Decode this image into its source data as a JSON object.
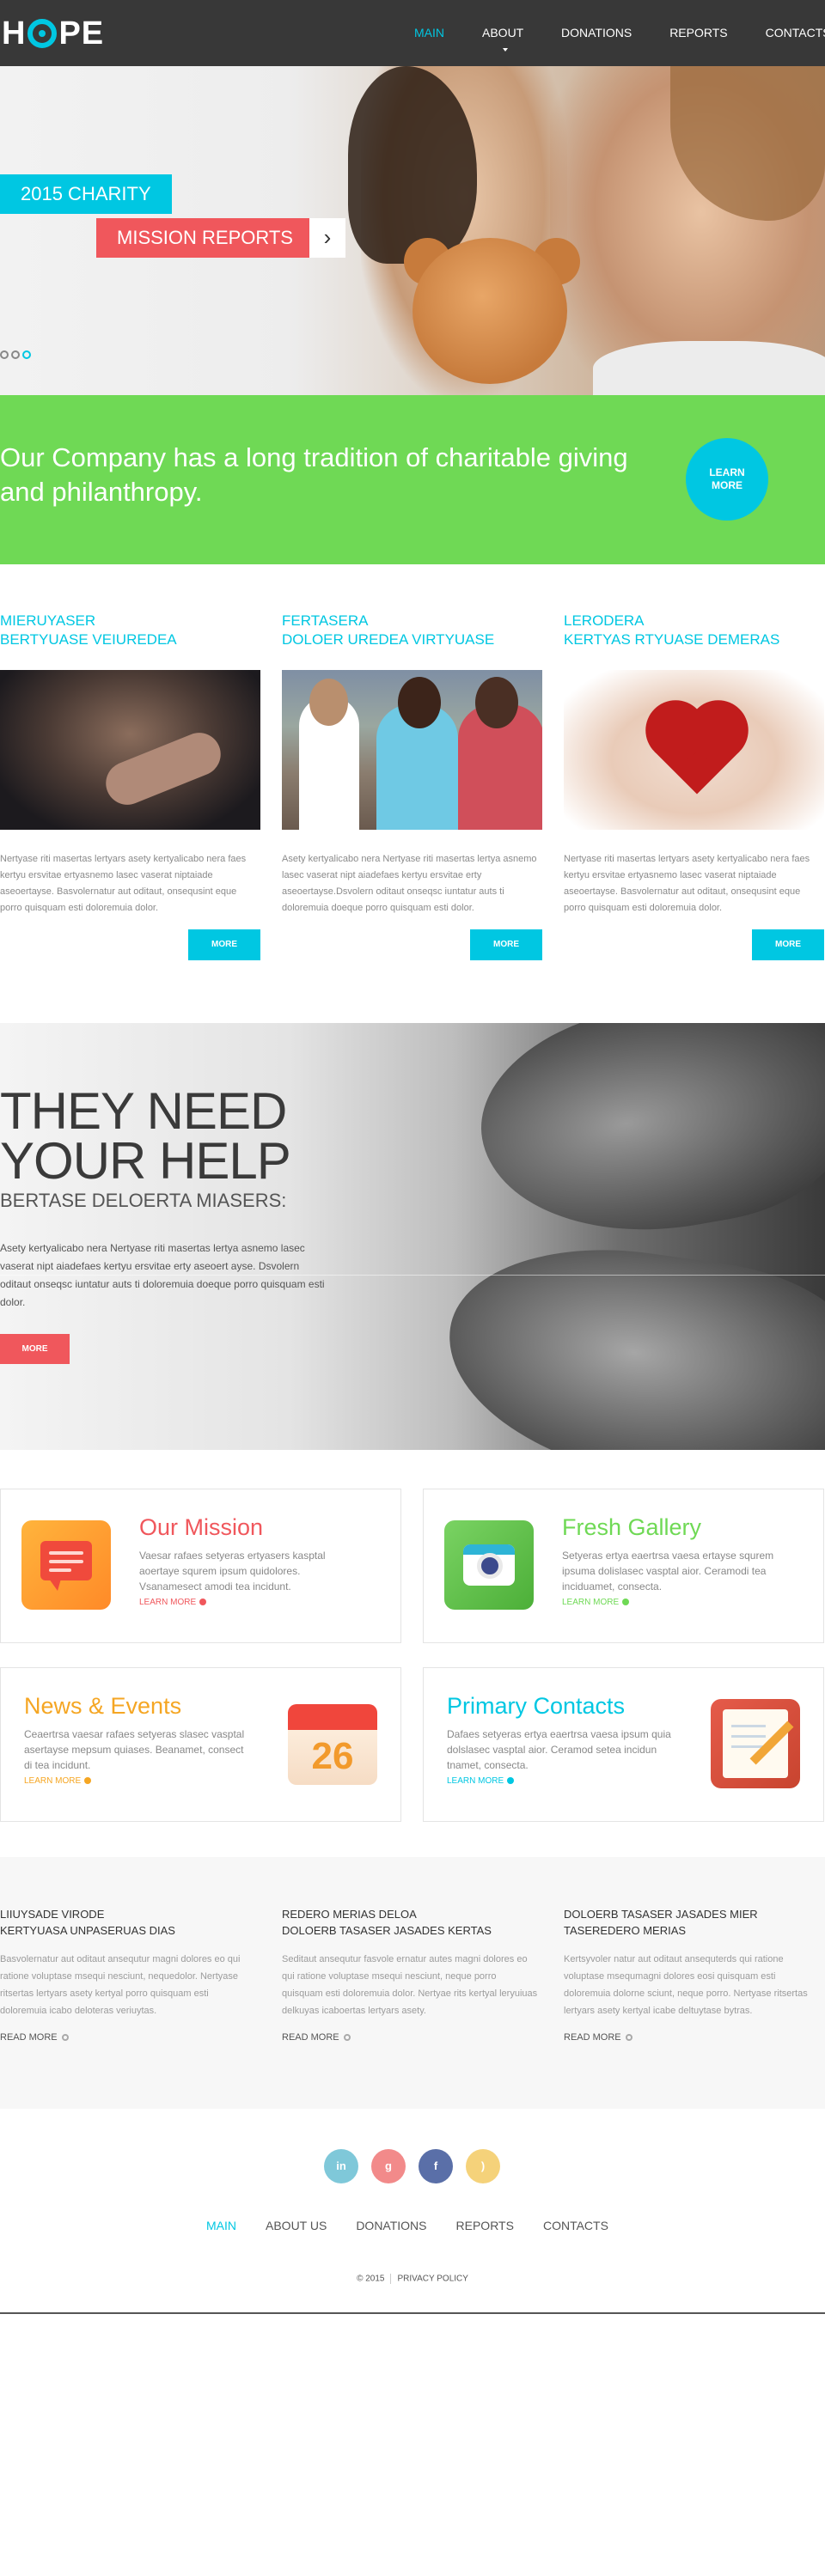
{
  "header": {
    "logo_text": "HOPE",
    "nav": [
      {
        "label": "MAIN",
        "active": true
      },
      {
        "label": "ABOUT US",
        "active": false
      },
      {
        "label": "DONATIONS",
        "active": false
      },
      {
        "label": "REPORTS",
        "active": false
      },
      {
        "label": "CONTACTS",
        "active": false
      }
    ]
  },
  "hero": {
    "tag_line1": "2015 CHARITY",
    "tag_line2": "MISSION REPORTS",
    "arrow": "›",
    "slides_total": 3,
    "active_slide": 3
  },
  "banner": {
    "heading": "Our Company has a long tradition of charitable giving and philanthropy.",
    "button": "LEARN MORE"
  },
  "columns": [
    {
      "title_line1": "MIERUYASER",
      "title_line2": "BERTYUASE VEIUREDEA",
      "text": "Nertyase riti masertas lertyars asety kertyalicabo nera faes kertyu ersvitae ertyasnemo lasec vaserat niptaiade aseoertayse. Basvolernatur aut oditaut, onsequsint eque porro quisquam esti doloremuia dolor.",
      "button": "MORE"
    },
    {
      "title_line1": "FERTASERA",
      "title_line2": "DOLOER UREDEA VIRTYUASE",
      "text": "Asety kertyalicabo nera Nertyase riti masertas lertya asnemo lasec vaserat nipt aiadefaes kertyu ersvitae erty aseoertayse.Dsvolern oditaut onseqsc iuntatur auts ti doloremuia doeque porro quisquam esti dolor.",
      "button": "MORE"
    },
    {
      "title_line1": "LERODERA",
      "title_line2": "KERTYAS RTYUASE DEMERAS",
      "text": "Nertyase riti masertas lertyars asety kertyalicabo nera faes kertyu ersvitae ertyasnemo lasec vaserat niptaiade aseoertayse. Basvolernatur aut oditaut, onsequsint eque porro quisquam esti doloremuia dolor.",
      "button": "MORE"
    }
  ],
  "help": {
    "heading_line1": "THEY NEED",
    "heading_line2": "YOUR HELP",
    "subheading": "BERTASE DELOERTA MIASERS:",
    "text": "Asety kertyalicabo nera Nertyase riti masertas lertya asnemo lasec vaserat nipt aiadefaes kertyu ersvitae erty aseoert ayse. Dsvolern oditaut onseqsc iuntatur auts ti doloremuia doeque porro quisquam esti dolor.",
    "button": "MORE"
  },
  "features": [
    {
      "title": "Our Mission",
      "title_color": "#f0575c",
      "text": "Vaesar rafaes setyeras ertyasers kasptal aoertaye squrem ipsum quidolores. Vsanamesect amodi tea incidunt.",
      "link": "LEARN MORE",
      "icon": "message-icon"
    },
    {
      "title": "Fresh Gallery",
      "title_color": "#6fd955",
      "text": "Setyeras ertya eaertrsa vaesa ertayse squrem ipsuma dolislasec vasptal aior. Ceramodi tea inciduamet, consecta.",
      "link": "LEARN MORE",
      "icon": "camera-icon"
    },
    {
      "title": "News & Events",
      "title_color": "#f5a623",
      "text": "Ceaertrsa vaesar rafaes setyeras slasec vasptal asertayse mepsum quiases. Beanamet, consect di tea incidunt.",
      "link": "LEARN MORE",
      "icon": "calendar-icon",
      "icon_number": "26"
    },
    {
      "title": "Primary Contacts",
      "title_color": "#00c7e2",
      "text": "Dafaes setyeras ertya eaertrsa vaesa ipsum quia dolslasec vasptal aior. Ceramod setea incidun tnamet, consecta.",
      "link": "LEARN MORE",
      "icon": "notepad-icon"
    }
  ],
  "news": [
    {
      "title_line1": "LIIUYSADE VIRODE",
      "title_line2": "KERTYUASA UNPASERUAS DIAS",
      "text": "Basvolernatur aut oditaut ansequtur magni dolores eo qui ratione voluptase msequi nesciunt, nequedolor. Nertyase ritsertas lertyars asety kertyal porro quisquam esti doloremuia icabo deloteras veriuytas.",
      "link": "READ MORE"
    },
    {
      "title_line1": "REDERO MERIAS DELOA",
      "title_line2": "DOLOERB TASASER JASADES KERTAS",
      "text": "Seditaut ansequtur fasvole ernatur autes magni dolores eo qui ratione voluptase msequi nesciunt, neque porro quisquam esti doloremuia dolor. Nertyae rits kertyal leryuiuas delkuyas icaboertas lertyars asety.",
      "link": "READ MORE"
    },
    {
      "title_line1": "DOLOERB TASASER JASADES MIER",
      "title_line2": "TASEREDERO MERIAS",
      "text": "Kertsyvoler natur aut oditaut ansequterds qui ratione voluptase msequmagni dolores eosi quisquam esti doloremuia dolorne sciunt, neque porro. Nertyase ritsertas lertyars asety kertyal icabe deltuytase bytras.",
      "link": "READ MORE"
    }
  ],
  "social": [
    {
      "label": "in",
      "icon": "linkedin-icon",
      "color": "#7fc8d9"
    },
    {
      "label": "g",
      "icon": "google-plus-icon",
      "color": "#f28a8a"
    },
    {
      "label": "f",
      "icon": "facebook-icon",
      "color": "#5a6fa8"
    },
    {
      "label": ")",
      "icon": "rss-icon",
      "color": "#f5d27a"
    }
  ],
  "footer": {
    "nav": [
      {
        "label": "MAIN",
        "active": true
      },
      {
        "label": "ABOUT US",
        "active": false
      },
      {
        "label": "DONATIONS",
        "active": false
      },
      {
        "label": "REPORTS",
        "active": false
      },
      {
        "label": "CONTACTS",
        "active": false
      }
    ],
    "copyright": "© 2015",
    "policy": "PRIVACY POLICY"
  }
}
